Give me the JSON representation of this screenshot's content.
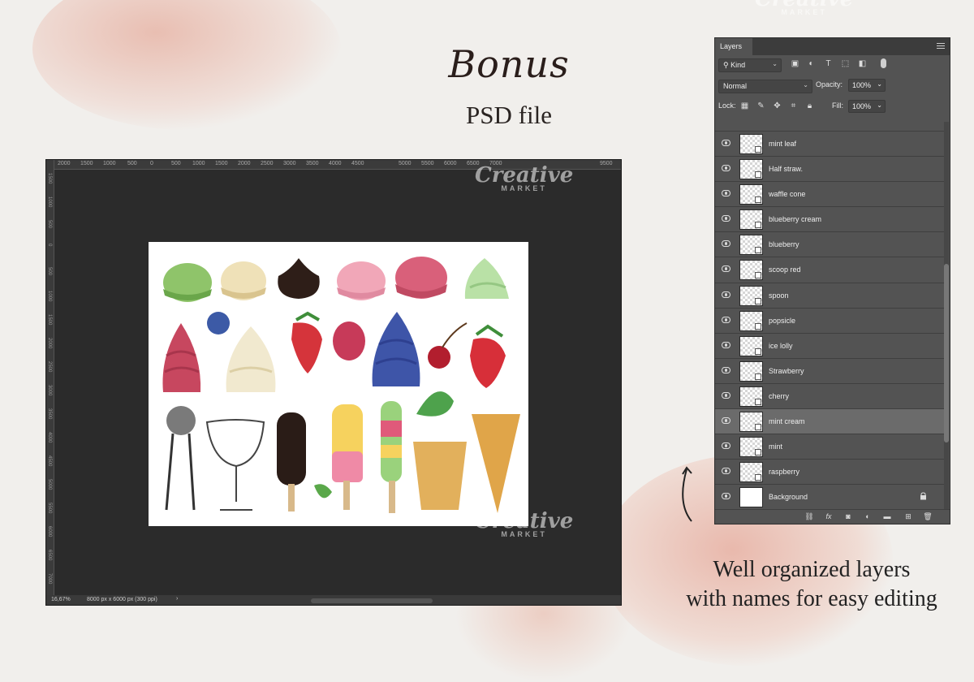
{
  "heading": {
    "title": "Bonus",
    "subtitle": "PSD file"
  },
  "caption": {
    "line1": "Well organized layers",
    "line2": "with names for easy editing"
  },
  "watermark": {
    "brand": "Creative",
    "sub": "MARKET"
  },
  "canvas": {
    "ruler_top_ticks": [
      "2000",
      "1500",
      "1000",
      "500",
      "0",
      "500",
      "1000",
      "1500",
      "2000",
      "2500",
      "3000",
      "3500",
      "4000",
      "4500",
      "5000",
      "5500",
      "6000",
      "6500",
      "7000",
      "9500"
    ],
    "ruler_left_ticks": [
      "1500",
      "1000",
      "500",
      "0",
      "500",
      "1000",
      "1500",
      "2000",
      "2500",
      "3000",
      "3500",
      "4000",
      "4500",
      "5000",
      "5500",
      "6000",
      "6500",
      "7000"
    ],
    "status_zoom": "16,67%",
    "status_size": "8000 px x 6000 px (300 ppi)",
    "status_arrow": "›"
  },
  "layers_panel": {
    "tab": "Layers",
    "filter_kind": "Kind",
    "blend_mode": "Normal",
    "opacity_label": "Opacity:",
    "opacity_value": "100%",
    "lock_label": "Lock:",
    "fill_label": "Fill:",
    "fill_value": "100%",
    "layers": [
      {
        "name": "mint leaf"
      },
      {
        "name": "Half straw."
      },
      {
        "name": "waffle cone"
      },
      {
        "name": "blueberry cream"
      },
      {
        "name": "blueberry"
      },
      {
        "name": "scoop red"
      },
      {
        "name": "spoon"
      },
      {
        "name": "popsicle"
      },
      {
        "name": "ice lolly"
      },
      {
        "name": "Strawberry"
      },
      {
        "name": "cherry"
      },
      {
        "name": "mint cream"
      },
      {
        "name": "mint"
      },
      {
        "name": "raspberry"
      },
      {
        "name": "Background"
      }
    ],
    "selected_layer": "mint cream"
  },
  "colors": {
    "background": "#f1efec",
    "panel": "#535353",
    "canvas_bg": "#2b2b2b",
    "accent_blot": "#e2968a"
  }
}
